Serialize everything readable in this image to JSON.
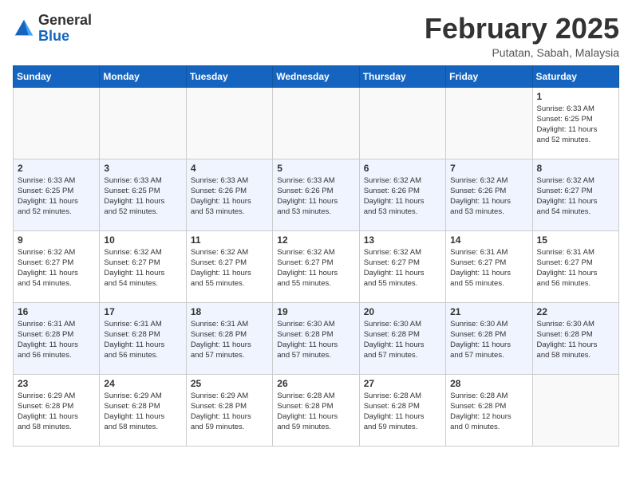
{
  "header": {
    "logo_general": "General",
    "logo_blue": "Blue",
    "month_title": "February 2025",
    "location": "Putatan, Sabah, Malaysia"
  },
  "weekdays": [
    "Sunday",
    "Monday",
    "Tuesday",
    "Wednesday",
    "Thursday",
    "Friday",
    "Saturday"
  ],
  "weeks": [
    [
      {
        "day": "",
        "info": ""
      },
      {
        "day": "",
        "info": ""
      },
      {
        "day": "",
        "info": ""
      },
      {
        "day": "",
        "info": ""
      },
      {
        "day": "",
        "info": ""
      },
      {
        "day": "",
        "info": ""
      },
      {
        "day": "1",
        "info": "Sunrise: 6:33 AM\nSunset: 6:25 PM\nDaylight: 11 hours\nand 52 minutes."
      }
    ],
    [
      {
        "day": "2",
        "info": "Sunrise: 6:33 AM\nSunset: 6:25 PM\nDaylight: 11 hours\nand 52 minutes."
      },
      {
        "day": "3",
        "info": "Sunrise: 6:33 AM\nSunset: 6:25 PM\nDaylight: 11 hours\nand 52 minutes."
      },
      {
        "day": "4",
        "info": "Sunrise: 6:33 AM\nSunset: 6:26 PM\nDaylight: 11 hours\nand 53 minutes."
      },
      {
        "day": "5",
        "info": "Sunrise: 6:33 AM\nSunset: 6:26 PM\nDaylight: 11 hours\nand 53 minutes."
      },
      {
        "day": "6",
        "info": "Sunrise: 6:32 AM\nSunset: 6:26 PM\nDaylight: 11 hours\nand 53 minutes."
      },
      {
        "day": "7",
        "info": "Sunrise: 6:32 AM\nSunset: 6:26 PM\nDaylight: 11 hours\nand 53 minutes."
      },
      {
        "day": "8",
        "info": "Sunrise: 6:32 AM\nSunset: 6:27 PM\nDaylight: 11 hours\nand 54 minutes."
      }
    ],
    [
      {
        "day": "9",
        "info": "Sunrise: 6:32 AM\nSunset: 6:27 PM\nDaylight: 11 hours\nand 54 minutes."
      },
      {
        "day": "10",
        "info": "Sunrise: 6:32 AM\nSunset: 6:27 PM\nDaylight: 11 hours\nand 54 minutes."
      },
      {
        "day": "11",
        "info": "Sunrise: 6:32 AM\nSunset: 6:27 PM\nDaylight: 11 hours\nand 55 minutes."
      },
      {
        "day": "12",
        "info": "Sunrise: 6:32 AM\nSunset: 6:27 PM\nDaylight: 11 hours\nand 55 minutes."
      },
      {
        "day": "13",
        "info": "Sunrise: 6:32 AM\nSunset: 6:27 PM\nDaylight: 11 hours\nand 55 minutes."
      },
      {
        "day": "14",
        "info": "Sunrise: 6:31 AM\nSunset: 6:27 PM\nDaylight: 11 hours\nand 55 minutes."
      },
      {
        "day": "15",
        "info": "Sunrise: 6:31 AM\nSunset: 6:27 PM\nDaylight: 11 hours\nand 56 minutes."
      }
    ],
    [
      {
        "day": "16",
        "info": "Sunrise: 6:31 AM\nSunset: 6:28 PM\nDaylight: 11 hours\nand 56 minutes."
      },
      {
        "day": "17",
        "info": "Sunrise: 6:31 AM\nSunset: 6:28 PM\nDaylight: 11 hours\nand 56 minutes."
      },
      {
        "day": "18",
        "info": "Sunrise: 6:31 AM\nSunset: 6:28 PM\nDaylight: 11 hours\nand 57 minutes."
      },
      {
        "day": "19",
        "info": "Sunrise: 6:30 AM\nSunset: 6:28 PM\nDaylight: 11 hours\nand 57 minutes."
      },
      {
        "day": "20",
        "info": "Sunrise: 6:30 AM\nSunset: 6:28 PM\nDaylight: 11 hours\nand 57 minutes."
      },
      {
        "day": "21",
        "info": "Sunrise: 6:30 AM\nSunset: 6:28 PM\nDaylight: 11 hours\nand 57 minutes."
      },
      {
        "day": "22",
        "info": "Sunrise: 6:30 AM\nSunset: 6:28 PM\nDaylight: 11 hours\nand 58 minutes."
      }
    ],
    [
      {
        "day": "23",
        "info": "Sunrise: 6:29 AM\nSunset: 6:28 PM\nDaylight: 11 hours\nand 58 minutes."
      },
      {
        "day": "24",
        "info": "Sunrise: 6:29 AM\nSunset: 6:28 PM\nDaylight: 11 hours\nand 58 minutes."
      },
      {
        "day": "25",
        "info": "Sunrise: 6:29 AM\nSunset: 6:28 PM\nDaylight: 11 hours\nand 59 minutes."
      },
      {
        "day": "26",
        "info": "Sunrise: 6:28 AM\nSunset: 6:28 PM\nDaylight: 11 hours\nand 59 minutes."
      },
      {
        "day": "27",
        "info": "Sunrise: 6:28 AM\nSunset: 6:28 PM\nDaylight: 11 hours\nand 59 minutes."
      },
      {
        "day": "28",
        "info": "Sunrise: 6:28 AM\nSunset: 6:28 PM\nDaylight: 12 hours\nand 0 minutes."
      },
      {
        "day": "",
        "info": ""
      }
    ]
  ]
}
